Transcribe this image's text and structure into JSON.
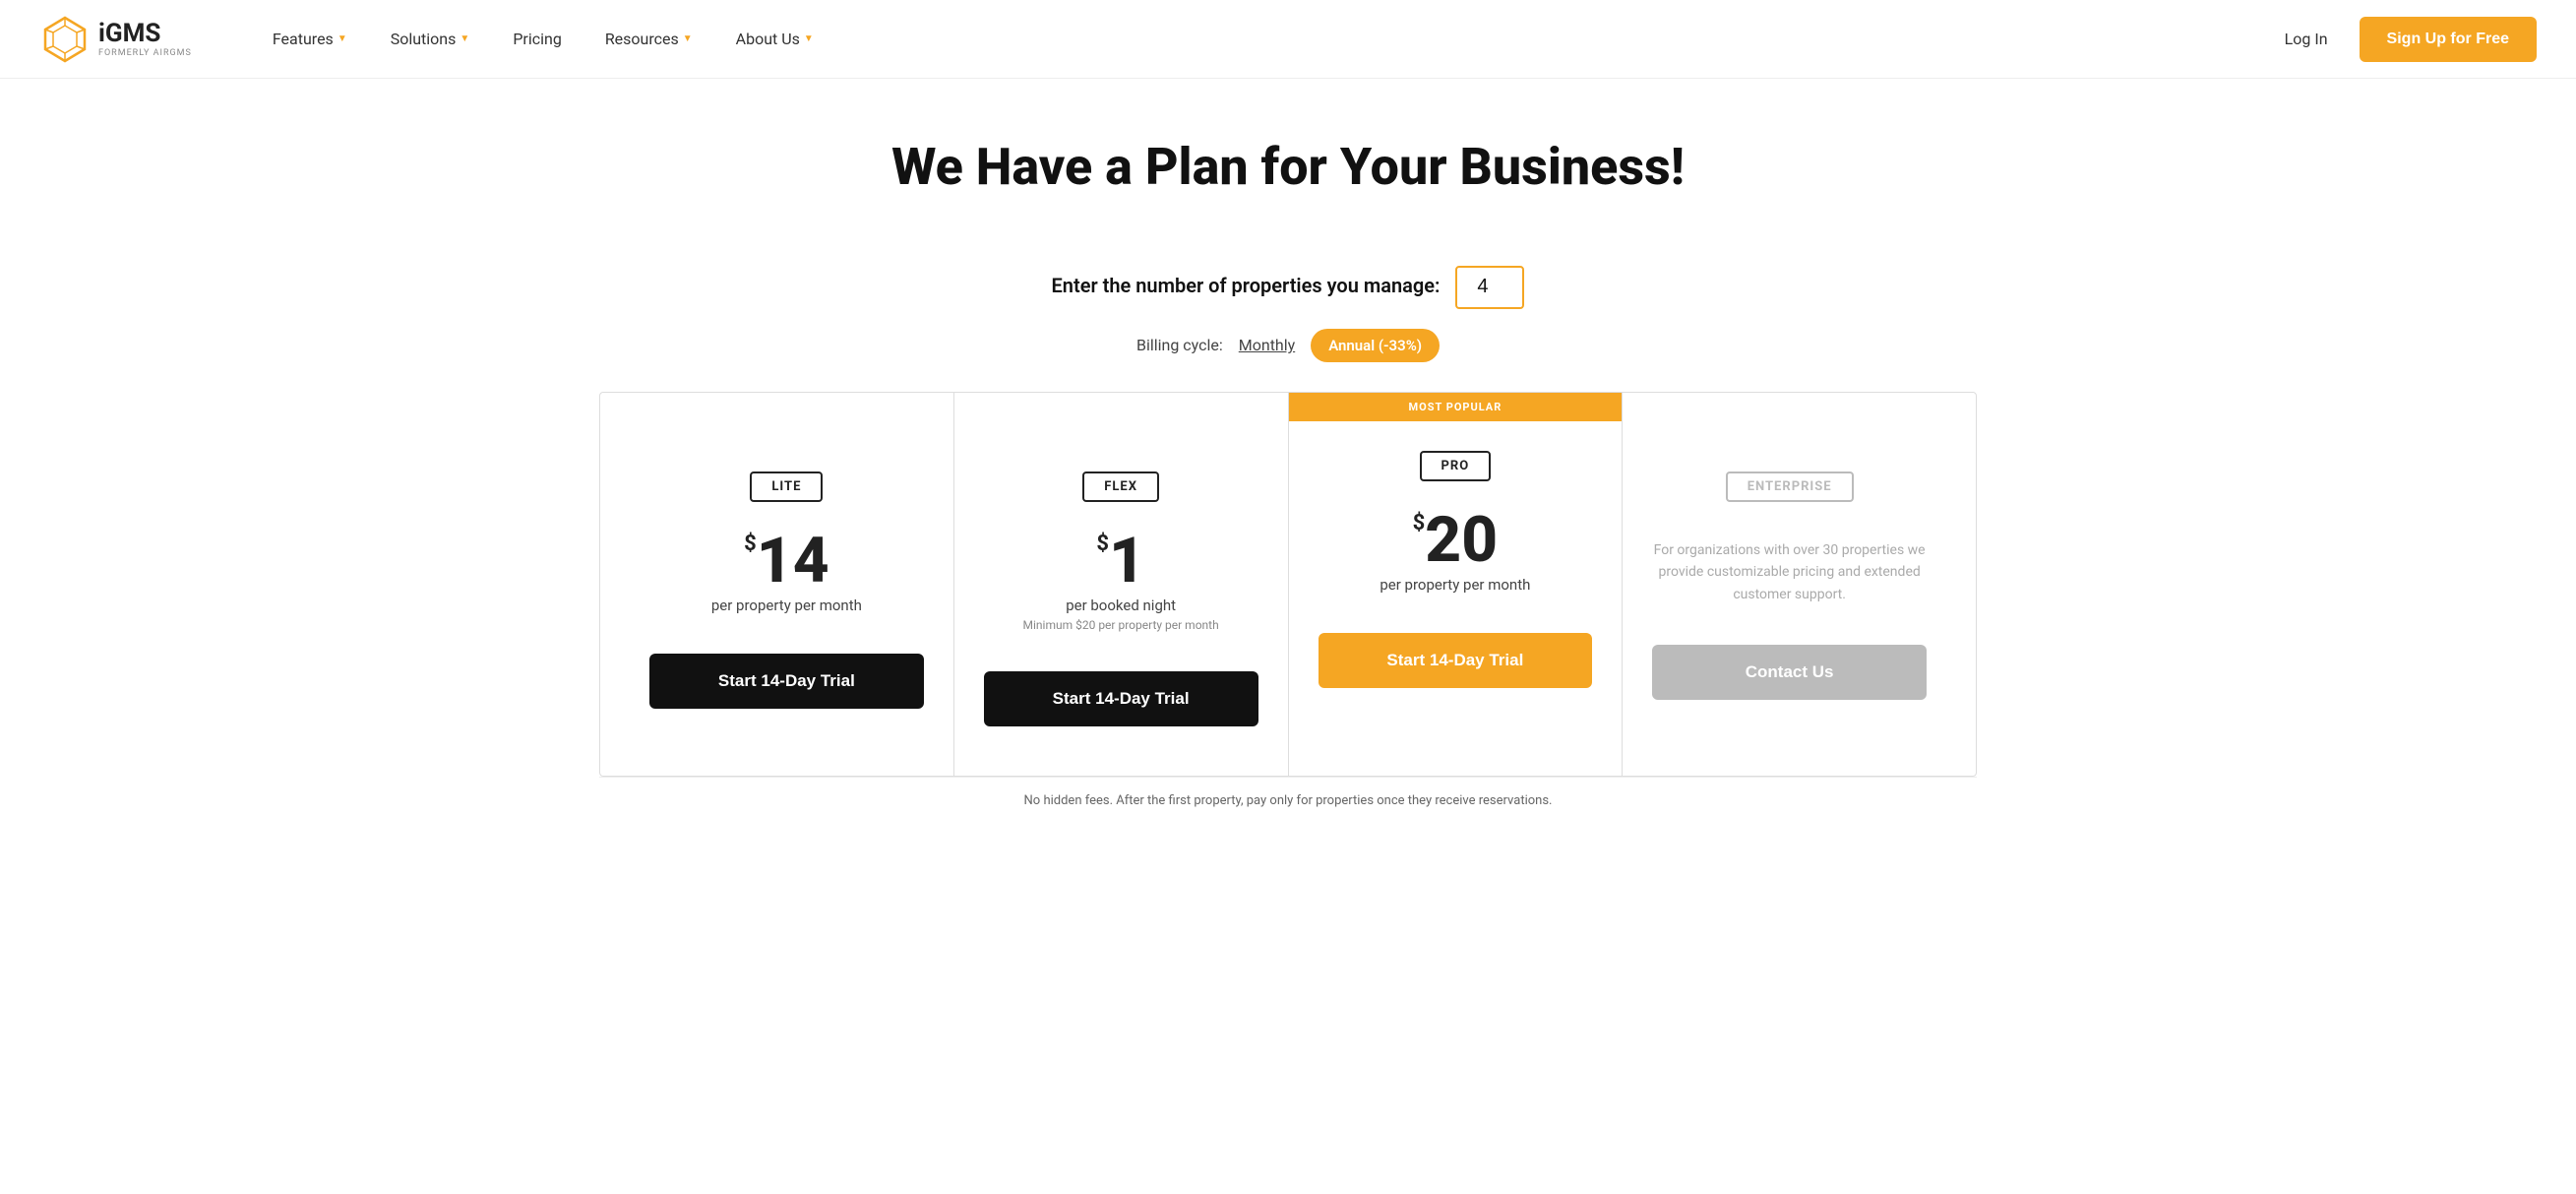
{
  "logo": {
    "title": "iGMS",
    "subtitle": "FORMERLY AIRGMS"
  },
  "nav": {
    "items": [
      {
        "label": "Features",
        "has_dropdown": true
      },
      {
        "label": "Solutions",
        "has_dropdown": true
      },
      {
        "label": "Pricing",
        "has_dropdown": false
      },
      {
        "label": "Resources",
        "has_dropdown": true
      },
      {
        "label": "About Us",
        "has_dropdown": true
      }
    ],
    "login_label": "Log In",
    "signup_label": "Sign Up for Free"
  },
  "hero": {
    "title": "We Have a Plan for Your Business!"
  },
  "properties": {
    "label": "Enter the number of properties you manage:",
    "value": "4"
  },
  "billing": {
    "label": "Billing cycle:",
    "monthly_label": "Monthly",
    "annual_label": "Annual (-33%)"
  },
  "plans": [
    {
      "id": "lite",
      "name": "LITE",
      "price_dollar": "$",
      "price_amount": "14",
      "price_unit": "per property per month",
      "price_note": "",
      "cta_label": "Start 14-Day Trial",
      "cta_style": "dark",
      "popular": false,
      "enterprise": false
    },
    {
      "id": "flex",
      "name": "FLEX",
      "price_dollar": "$",
      "price_amount": "1",
      "price_unit": "per booked night",
      "price_note": "Minimum $20 per property per month",
      "cta_label": "Start 14-Day Trial",
      "cta_style": "dark",
      "popular": false,
      "enterprise": false
    },
    {
      "id": "pro",
      "name": "PRO",
      "most_popular_label": "MOST POPULAR",
      "price_dollar": "$",
      "price_amount": "20",
      "price_unit": "per property per month",
      "price_note": "",
      "cta_label": "Start 14-Day Trial",
      "cta_style": "gold",
      "popular": true,
      "enterprise": false
    },
    {
      "id": "enterprise",
      "name": "ENTERPRISE",
      "price_dollar": "",
      "price_amount": "",
      "price_unit": "",
      "price_note": "",
      "enterprise_desc": "For organizations with over 30 properties we provide customizable pricing and extended customer support.",
      "cta_label": "Contact Us",
      "cta_style": "gray",
      "popular": false,
      "enterprise": true
    }
  ],
  "footer_note": "No hidden fees. After the first property, pay only for properties once they receive reservations."
}
